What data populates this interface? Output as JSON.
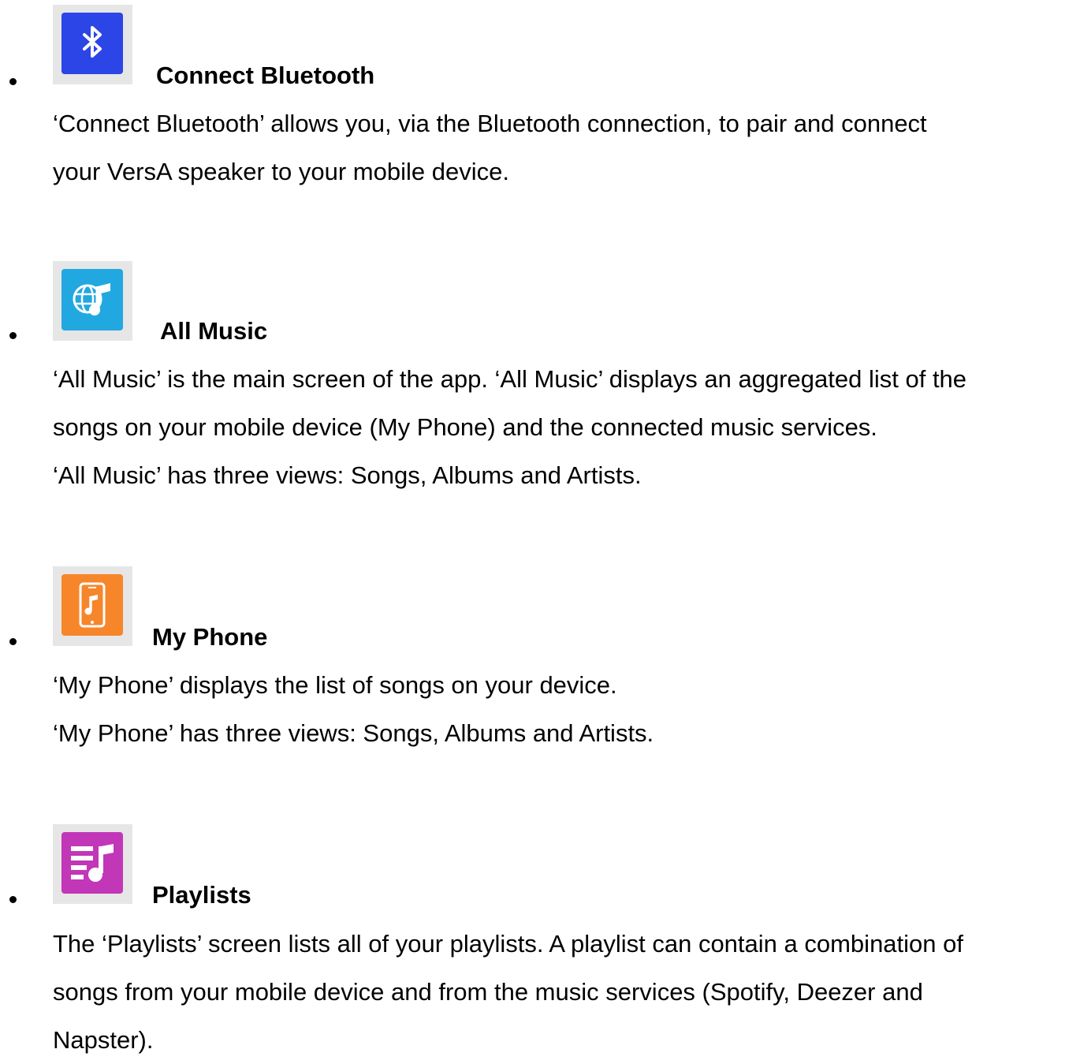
{
  "colors": {
    "bluetooth": "#2b45e6",
    "all_music": "#22a8e0",
    "my_phone": "#f7862a",
    "playlists": "#c236b8",
    "tile_bg": "#e6e6e6"
  },
  "items": [
    {
      "icon": "bluetooth-icon",
      "title": "Connect Bluetooth",
      "lines": [
        "‘Connect Bluetooth’ allows you, via the Bluetooth connection, to pair and connect",
        "your VersA speaker to your mobile device."
      ]
    },
    {
      "icon": "globe-music-icon",
      "title": "All Music",
      "lines": [
        "‘All Music’ is the main screen of the app. ‘All Music’ displays an aggregated list of the",
        "songs on your mobile device (My Phone) and the connected music services.",
        "‘All Music’ has three views: Songs, Albums and Artists."
      ]
    },
    {
      "icon": "phone-music-icon",
      "title": "My Phone",
      "lines": [
        "‘My Phone’ displays the list of songs on your device.",
        "‘My Phone’ has three views: Songs, Albums and Artists."
      ]
    },
    {
      "icon": "playlist-icon",
      "title": "Playlists",
      "lines": [
        "The ‘Playlists’ screen lists all of your playlists. A playlist can contain a combination of",
        "songs from your mobile device and from the music services (Spotify, Deezer and",
        "Napster)."
      ]
    }
  ]
}
